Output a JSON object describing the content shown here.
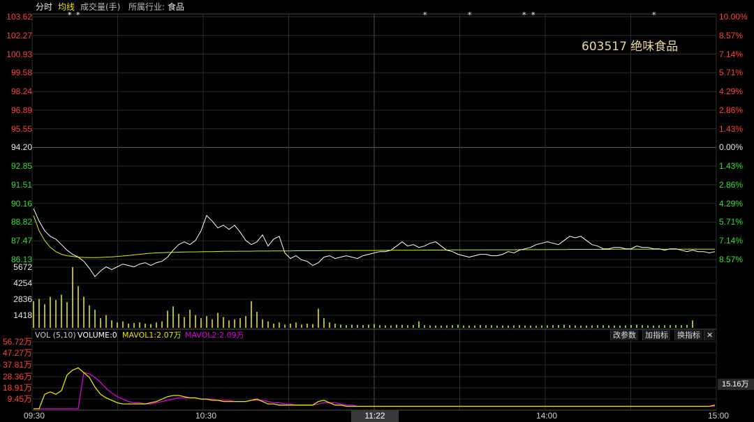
{
  "toolbar": {
    "tab_timeshare": "分时",
    "tab_avg_line": "均线",
    "tab_volume": "成交量(手)",
    "industry_label": "所属行业:",
    "industry_value": "食品"
  },
  "stock": {
    "code_name": "603517 绝味食品"
  },
  "price_axis": {
    "left": [
      "103.62",
      "102.27",
      "100.93",
      "99.58",
      "98.24",
      "96.89",
      "95.55",
      "94.20",
      "92.85",
      "91.51",
      "90.16",
      "88.82",
      "87.47",
      "86.13"
    ],
    "right": [
      "10.00%",
      "8.57%",
      "7.14%",
      "5.71%",
      "4.29%",
      "2.86%",
      "1.43%",
      "0.00%",
      "1.43%",
      "2.86%",
      "4.29%",
      "5.71%",
      "7.14%",
      "8.57%"
    ]
  },
  "volume_axis": [
    "5672",
    "4254",
    "2836",
    "1418"
  ],
  "volume_info": {
    "indicator": "VOL (5,10)",
    "volume": "VOLUME:0",
    "mavol1": "MAVOL1:2.07万",
    "mavol2": "MAVOL2:2.09万",
    "btn_change_params": "改参数",
    "btn_add_indicator": "加指标",
    "btn_switch_indicator": "换指标",
    "btn_close": "✕"
  },
  "mavol_axis": [
    "56.72万",
    "47.27万",
    "37.81万",
    "28.36万",
    "18.91万",
    "9.45万"
  ],
  "mavol_right_value": "15.16万",
  "time_axis": {
    "t1": "09:30",
    "t2": "10:30",
    "t3": "14:00",
    "t4": "15:00",
    "cursor": "11:22"
  },
  "colors": {
    "price_line": "#ffffff",
    "avg_line": "#e6e600",
    "volume_bar": "#e6e600",
    "mavol1": "#e6e600",
    "mavol2": "#e000e0",
    "grid": "#2c2c2c",
    "red": "#ff4040",
    "green": "#33e033"
  },
  "chart_data": {
    "type": "line",
    "price_series": [
      89.8,
      88.9,
      88.2,
      87.8,
      87.6,
      87.2,
      86.8,
      86.5,
      86.3,
      86.0,
      85.5,
      84.9,
      85.3,
      85.6,
      85.4,
      85.6,
      85.8,
      85.7,
      85.6,
      85.8,
      85.9,
      85.7,
      85.9,
      86.0,
      86.3,
      86.8,
      87.2,
      87.4,
      87.2,
      87.5,
      88.2,
      89.3,
      88.9,
      88.4,
      88.6,
      88.3,
      88.6,
      88.1,
      87.5,
      87.2,
      87.4,
      87.9,
      87.1,
      87.6,
      87.8,
      86.6,
      86.2,
      86.4,
      86.1,
      86.0,
      85.7,
      85.9,
      86.3,
      86.4,
      86.2,
      86.3,
      86.4,
      86.3,
      86.2,
      86.4,
      86.5,
      86.6,
      86.7,
      86.7,
      86.8,
      87.1,
      87.4,
      87.1,
      87.2,
      87.0,
      87.1,
      87.3,
      87.4,
      87.1,
      86.8,
      86.7,
      86.5,
      86.4,
      86.3,
      86.4,
      86.5,
      86.5,
      86.4,
      86.4,
      86.5,
      86.7,
      86.6,
      86.8,
      86.9,
      87.0,
      87.2,
      87.3,
      87.4,
      87.3,
      87.2,
      87.5,
      87.8,
      87.7,
      87.8,
      87.5,
      87.2,
      87.1,
      86.9,
      86.9,
      87.0,
      87.0,
      86.9,
      86.9,
      87.1,
      87.0,
      87.0,
      86.9,
      86.9,
      86.8,
      86.9,
      86.9,
      86.8,
      86.7,
      86.8,
      86.7,
      86.7,
      86.6,
      86.7
    ],
    "avg_series": [
      89.3,
      88.2,
      87.5,
      87.0,
      86.7,
      86.5,
      86.4,
      86.35,
      86.3,
      86.28,
      86.27,
      86.27,
      86.28,
      86.3,
      86.32,
      86.35,
      86.38,
      86.42,
      86.46,
      86.5,
      86.54,
      86.58,
      86.6,
      86.62,
      86.64,
      86.65,
      86.66,
      86.67,
      86.68,
      86.68,
      86.69,
      86.7,
      86.7,
      86.71,
      86.72,
      86.72,
      86.72,
      86.73,
      86.73,
      86.73,
      86.74,
      86.74,
      86.74,
      86.75,
      86.75,
      86.75,
      86.75,
      86.76,
      86.76,
      86.76,
      86.76,
      86.76,
      86.77,
      86.77,
      86.77,
      86.77,
      86.77,
      86.78,
      86.78,
      86.78,
      86.78,
      86.78,
      86.79,
      86.79,
      86.79,
      86.8,
      86.8,
      86.8,
      86.8,
      86.8,
      86.81,
      86.81,
      86.81,
      86.81,
      86.81,
      86.82,
      86.82,
      86.82,
      86.82,
      86.82,
      86.82,
      86.83,
      86.83,
      86.83,
      86.83,
      86.83,
      86.83,
      86.84,
      86.84,
      86.84,
      86.84,
      86.84,
      86.85,
      86.85,
      86.85,
      86.85,
      86.86,
      86.86,
      86.86,
      86.86,
      86.86,
      86.86,
      86.86,
      86.86,
      86.87,
      86.87,
      86.87,
      86.87,
      86.87,
      86.87,
      86.87,
      86.87,
      86.87,
      86.87,
      86.87,
      86.87,
      86.87,
      86.87,
      86.87,
      86.87,
      86.87,
      86.87,
      86.87
    ],
    "volume_series": [
      2500,
      2700,
      2200,
      2900,
      2600,
      3100,
      2400,
      5672,
      3900,
      2900,
      2100,
      1700,
      900,
      1200,
      700,
      500,
      600,
      400,
      450,
      500,
      400,
      350,
      500,
      600,
      1600,
      2000,
      1300,
      1000,
      1700,
      1200,
      900,
      1100,
      800,
      1400,
      1000,
      700,
      800,
      900,
      1100,
      2500,
      1500,
      800,
      600,
      400,
      500,
      300,
      400,
      500,
      300,
      400,
      350,
      1800,
      900,
      500,
      400,
      300,
      250,
      300,
      280,
      260,
      300,
      350,
      250,
      230,
      220,
      300,
      280,
      240,
      260,
      600,
      250,
      220,
      210,
      200,
      230,
      250,
      300,
      220,
      210,
      200,
      260,
      230,
      240,
      200,
      220,
      210,
      230,
      250,
      200,
      210,
      190,
      220,
      230,
      250,
      260,
      300,
      240,
      220,
      200,
      210,
      230,
      250,
      240,
      220,
      210,
      200,
      230,
      260,
      300,
      250,
      220,
      210,
      230,
      240,
      250,
      260,
      240,
      280,
      700
    ],
    "mavol1_series": [
      0,
      0,
      12,
      14,
      12,
      15,
      28,
      32,
      34,
      30,
      26,
      18,
      12,
      9,
      7,
      5,
      4,
      4,
      4,
      4,
      4,
      5,
      6,
      8,
      10,
      11,
      11,
      10,
      9,
      9,
      8,
      8,
      7,
      7,
      6,
      6,
      6,
      6,
      6,
      7,
      8,
      6,
      4,
      4,
      3,
      3,
      3,
      3,
      3,
      3,
      3,
      6,
      7,
      5,
      3,
      3,
      2,
      2,
      2,
      2,
      2,
      2,
      2,
      2,
      2,
      2,
      2,
      2,
      2,
      2,
      2,
      2,
      2,
      2,
      2,
      2,
      2,
      2,
      2,
      2,
      2,
      2,
      2,
      2,
      2,
      2,
      2,
      2,
      2,
      2,
      2,
      2,
      2,
      2,
      2,
      2,
      2,
      2,
      2,
      2,
      2,
      2,
      2,
      2,
      2,
      2,
      2,
      2,
      2,
      2,
      2,
      2,
      2,
      2,
      2,
      2,
      2,
      2,
      2,
      2,
      2,
      2,
      3
    ],
    "mavol2_series": [
      0,
      0,
      0,
      0,
      0,
      0,
      0,
      0,
      0,
      30,
      29,
      26,
      22,
      17,
      13,
      10,
      8,
      6,
      5,
      5,
      4,
      4,
      5,
      6,
      7,
      8,
      9,
      9,
      9,
      9,
      8,
      8,
      8,
      7,
      7,
      7,
      6,
      6,
      6,
      7,
      7,
      7,
      6,
      5,
      5,
      4,
      4,
      3,
      3,
      3,
      3,
      4,
      5,
      5,
      5,
      4,
      3,
      3,
      2,
      2,
      2,
      2,
      2,
      2,
      2,
      2,
      2,
      2,
      2,
      2,
      2,
      2,
      2,
      2,
      2,
      2,
      2,
      2,
      2,
      2,
      2,
      2,
      2,
      2,
      2,
      2,
      2,
      2,
      2,
      2,
      2,
      2,
      2,
      2,
      2,
      2,
      2,
      2,
      2,
      2,
      2,
      2,
      2,
      2,
      2,
      2,
      2,
      2,
      2,
      2,
      2,
      2,
      2,
      2,
      2,
      2,
      2,
      2,
      2,
      2,
      2,
      2,
      2
    ],
    "price_range": [
      85.5,
      103.62
    ],
    "volume_range": [
      0,
      5672
    ],
    "mavol_range": [
      0,
      56.72
    ],
    "star_columns": [
      3,
      6,
      7,
      32,
      35,
      40,
      41,
      48
    ]
  }
}
